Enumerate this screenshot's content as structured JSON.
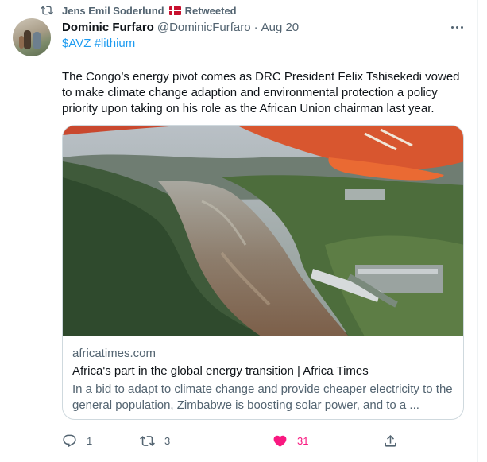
{
  "retweet": {
    "by": "Jens Emil Soderlund",
    "label": "Retweeted",
    "icon": "retweet-icon",
    "flag": "denmark-flag"
  },
  "author": {
    "name": "Dominic Furfaro",
    "handle": "@DominicFurfaro",
    "separator": "·",
    "date": "Aug 20",
    "avatar": "profile-photo"
  },
  "tags": {
    "cashtag": "$AVZ",
    "hashtag": "#lithium"
  },
  "tweet_text": "The Congo’s energy pivot comes as DRC President Felix Tshisekedi vowed to make climate change adaption and environmental protection a policy priority upon taking on his role as the African Union chairman last year.",
  "card": {
    "image": "aerial-river-dam-photo",
    "domain": "africatimes.com",
    "title": "Africa's part in the global energy transition | Africa Times",
    "description": "In a bid to adapt to climate change and provide cheaper electricity to the general population, Zimbabwe is boosting solar power, and to a ..."
  },
  "actions": {
    "reply_count": "1",
    "retweet_count": "3",
    "like_count": "31",
    "like_color": "#f91880",
    "link_color": "#1d9bf0"
  }
}
